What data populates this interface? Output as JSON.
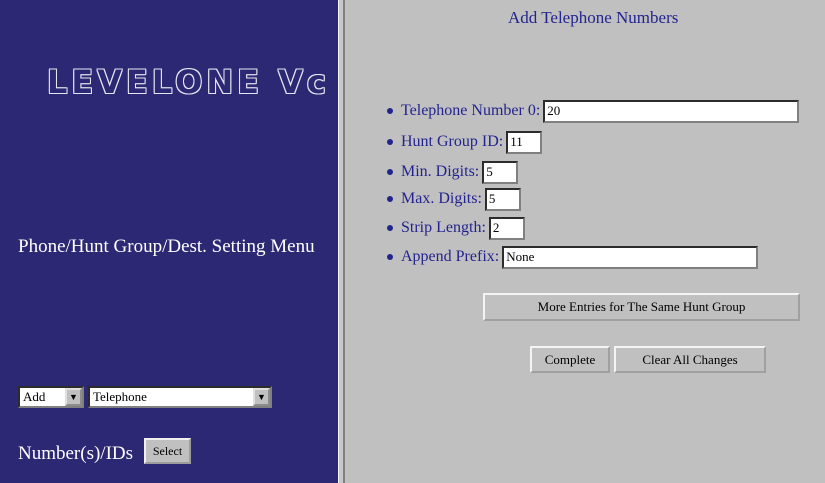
{
  "left": {
    "logo_text": "LEVELONE Vc",
    "menu_title": "Phone/Hunt Group/Dest. Setting Menu",
    "action_select": "Add",
    "type_select": "Telephone",
    "numbers_label": "Number(s)/IDs",
    "select_button": "Select"
  },
  "right": {
    "title": "Add Telephone Numbers",
    "fields": [
      {
        "label": "Telephone Number 0:",
        "value": "20"
      },
      {
        "label": "Hunt Group ID:",
        "value": "11"
      },
      {
        "label": "Min. Digits:",
        "value": "5"
      },
      {
        "label": "Max. Digits:",
        "value": "5"
      },
      {
        "label": "Strip Length:",
        "value": "2"
      },
      {
        "label": "Append Prefix:",
        "value": "None"
      }
    ],
    "more_entries_button": "More Entries for The Same Hunt Group",
    "complete_button": "Complete",
    "clear_button": "Clear All Changes"
  }
}
